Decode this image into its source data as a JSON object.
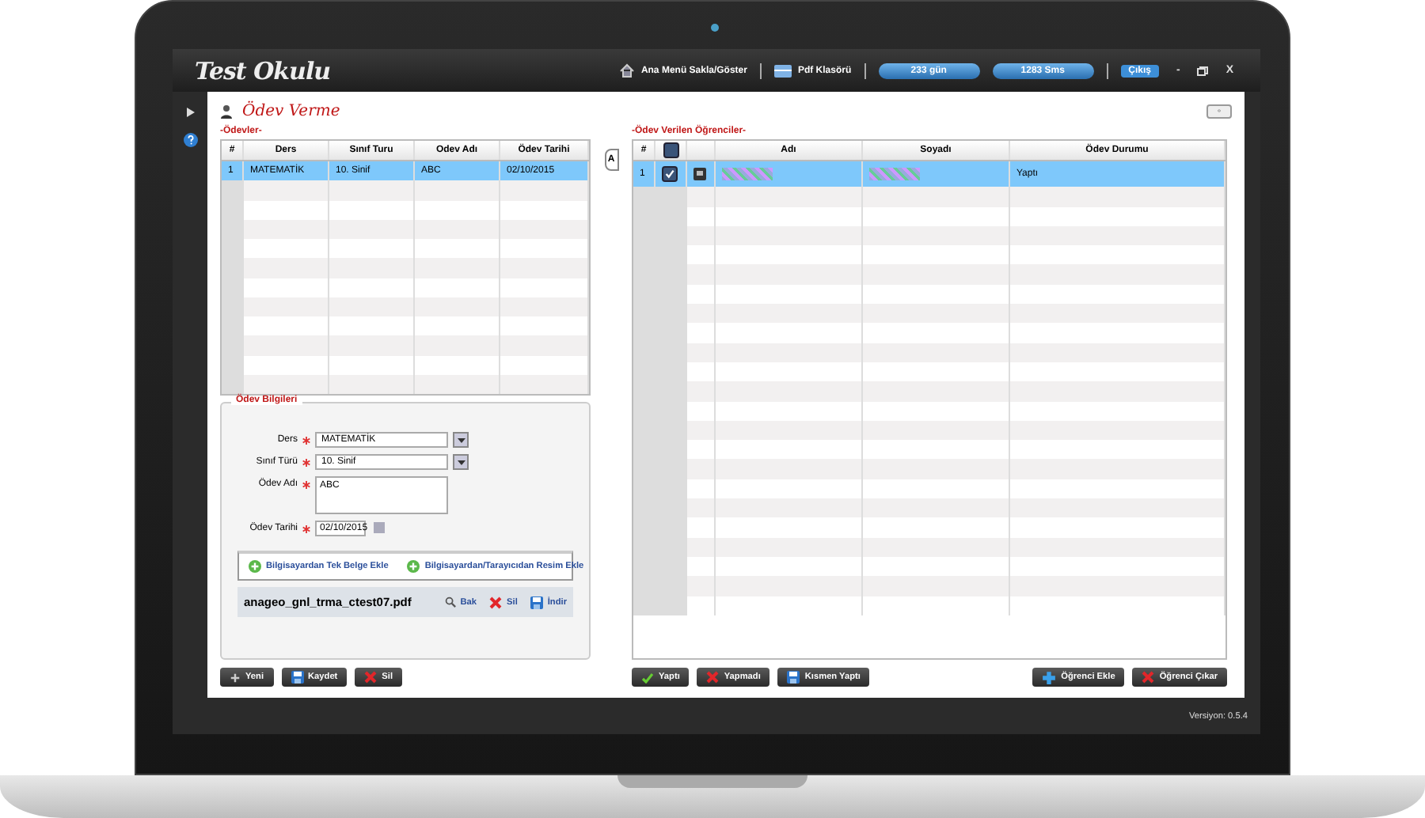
{
  "app": {
    "logo": "Test Okulu"
  },
  "topbar": {
    "menu_toggle": "Ana Menü Sakla/Göster",
    "pdf_folder": "Pdf Klasörü",
    "days": "233 gün",
    "sms": "1283 Sms",
    "logout": "Çıkış",
    "minimize": "-",
    "close": "X"
  },
  "page_title": "Ödev Verme",
  "homework": {
    "section_title": "-Ödevler-",
    "columns": [
      "#",
      "Ders",
      "Sınıf Turu",
      "Odev Adı",
      "Ödev Tarihi"
    ],
    "rows": [
      {
        "cells": [
          "1",
          "MATEMATİK",
          "10. Sinif",
          "ABC",
          "02/10/2015"
        ],
        "selected": true
      }
    ]
  },
  "form": {
    "title": "Ödev Bilgileri",
    "fields": [
      {
        "kind": "select",
        "label": "Ders",
        "value": "MATEMATİK",
        "required": true
      },
      {
        "kind": "select",
        "label": "Sınıf Türü",
        "value": "10. Sinif",
        "required": true
      },
      {
        "kind": "textarea",
        "label": "Ödev Adı",
        "value": "ABC",
        "required": true
      },
      {
        "kind": "date",
        "label": "Ödev Tarihi",
        "value": "02/10/2015",
        "required": true
      }
    ],
    "attach_buttons": [
      "Bilgisayardan Tek Belge Ekle",
      "Bilgisayardan/Tarayıcıdan Resim Ekle"
    ],
    "file": {
      "name": "anageo_gnl_trma_ctest07.pdf",
      "actions": [
        {
          "kind": "view",
          "label": "Bak"
        },
        {
          "kind": "delete",
          "label": "Sil"
        },
        {
          "kind": "download",
          "label": "İndir"
        }
      ]
    }
  },
  "left_buttons": [
    {
      "kind": "new",
      "label": "Yeni"
    },
    {
      "kind": "save",
      "label": "Kaydet"
    },
    {
      "kind": "delete",
      "label": "Sil"
    }
  ],
  "side_tab": "A",
  "students": {
    "section_title": "-Ödev Verilen Öğrenciler-",
    "columns": [
      "#",
      "Adı",
      "Soyadı",
      "Ödev Durumu"
    ],
    "all_checked": false,
    "rows": [
      {
        "number": "1",
        "checked": true,
        "selected": true,
        "status": "Yaptı"
      }
    ]
  },
  "student_buttons": [
    {
      "kind": "done",
      "label": "Yaptı"
    },
    {
      "kind": "not_done",
      "label": "Yapmadı"
    },
    {
      "kind": "save",
      "label": "Kısmen Yaptı"
    }
  ],
  "student_manage": [
    {
      "kind": "add",
      "label": "Öğrenci Ekle"
    },
    {
      "kind": "delete",
      "label": "Öğrenci Çıkar"
    }
  ],
  "version": "Versiyon: 0.5.4"
}
